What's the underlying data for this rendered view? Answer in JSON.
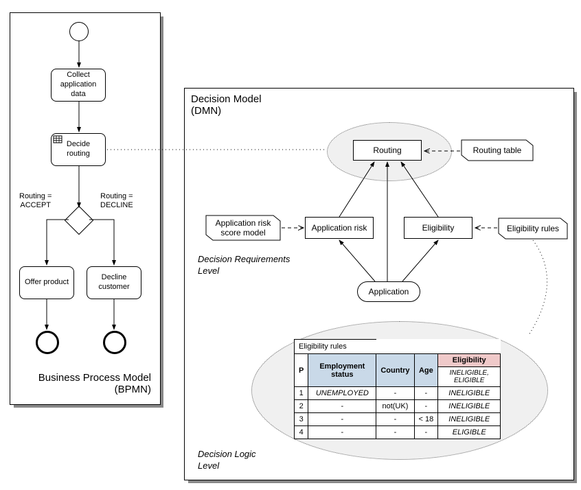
{
  "bpmn": {
    "title": "Business Process Model\n(BPMN)",
    "tasks": {
      "collect": "Collect application data",
      "decide": "Decide routing",
      "offer": "Offer product",
      "decline": "Decline customer"
    },
    "conditions": {
      "accept": "Routing =\nACCEPT",
      "decline": "Routing =\nDECLINE"
    }
  },
  "dmn": {
    "title": "Decision Model\n(DMN)",
    "levels": {
      "req": "Decision Requirements\nLevel",
      "logic": "Decision Logic\nLevel"
    },
    "decisions": {
      "routing": "Routing",
      "app_risk": "Application risk",
      "eligibility": "Eligibility"
    },
    "inputs": {
      "application": "Application"
    },
    "knowledge": {
      "routing_table": "Routing table",
      "risk_model": "Application risk score model",
      "elig_rules": "Eligibility rules"
    },
    "table": {
      "title": "Eligibility rules",
      "hit": "P",
      "headers": {
        "emp": "Employment status",
        "country": "Country",
        "age": "Age",
        "elig": "Eligibility"
      },
      "output_domain": "INELIGIBLE, ELIGIBLE",
      "rows": [
        {
          "n": "1",
          "emp": "UNEMPLOYED",
          "country": "-",
          "age": "-",
          "out": "INELIGIBLE"
        },
        {
          "n": "2",
          "emp": "-",
          "country": "not(UK)",
          "age": "-",
          "out": "INELIGIBLE"
        },
        {
          "n": "3",
          "emp": "-",
          "country": "-",
          "age": "< 18",
          "out": "INELIGIBLE"
        },
        {
          "n": "4",
          "emp": "-",
          "country": "-",
          "age": "-",
          "out": "ELIGIBLE"
        }
      ]
    }
  },
  "chart_data": {
    "type": "diagram",
    "note": "Conceptual BPMN+DMN diagram; nodes and edges listed",
    "bpmn_flow": [
      "start",
      "Collect application data",
      "Decide routing",
      "gateway",
      {
        "branch": "Routing = ACCEPT",
        "to": "Offer product",
        "end": "end1"
      },
      {
        "branch": "Routing = DECLINE",
        "to": "Decline customer",
        "end": "end2"
      }
    ],
    "dmn_nodes": {
      "decisions": [
        "Routing",
        "Application risk",
        "Eligibility"
      ],
      "input_data": [
        "Application"
      ],
      "knowledge_sources": [
        "Routing table",
        "Application risk score model",
        "Eligibility rules"
      ]
    },
    "dmn_edges": [
      {
        "from": "Application risk",
        "to": "Routing"
      },
      {
        "from": "Eligibility",
        "to": "Routing"
      },
      {
        "from": "Application",
        "to": "Routing"
      },
      {
        "from": "Application",
        "to": "Application risk"
      },
      {
        "from": "Application",
        "to": "Eligibility"
      },
      {
        "from": "Routing table",
        "to": "Routing",
        "type": "authority"
      },
      {
        "from": "Application risk score model",
        "to": "Application risk",
        "type": "authority"
      },
      {
        "from": "Eligibility rules",
        "to": "Eligibility",
        "type": "authority"
      }
    ],
    "decision_table": {
      "name": "Eligibility rules",
      "hit_policy": "P",
      "inputs": [
        "Employment status",
        "Country",
        "Age"
      ],
      "output": "Eligibility",
      "output_values": [
        "INELIGIBLE",
        "ELIGIBLE"
      ],
      "rules": [
        {
          "Employment status": "UNEMPLOYED",
          "Country": "-",
          "Age": "-",
          "Eligibility": "INELIGIBLE"
        },
        {
          "Employment status": "-",
          "Country": "not(UK)",
          "Age": "-",
          "Eligibility": "INELIGIBLE"
        },
        {
          "Employment status": "-",
          "Country": "-",
          "Age": "< 18",
          "Eligibility": "INELIGIBLE"
        },
        {
          "Employment status": "-",
          "Country": "-",
          "Age": "-",
          "Eligibility": "ELIGIBLE"
        }
      ]
    }
  }
}
